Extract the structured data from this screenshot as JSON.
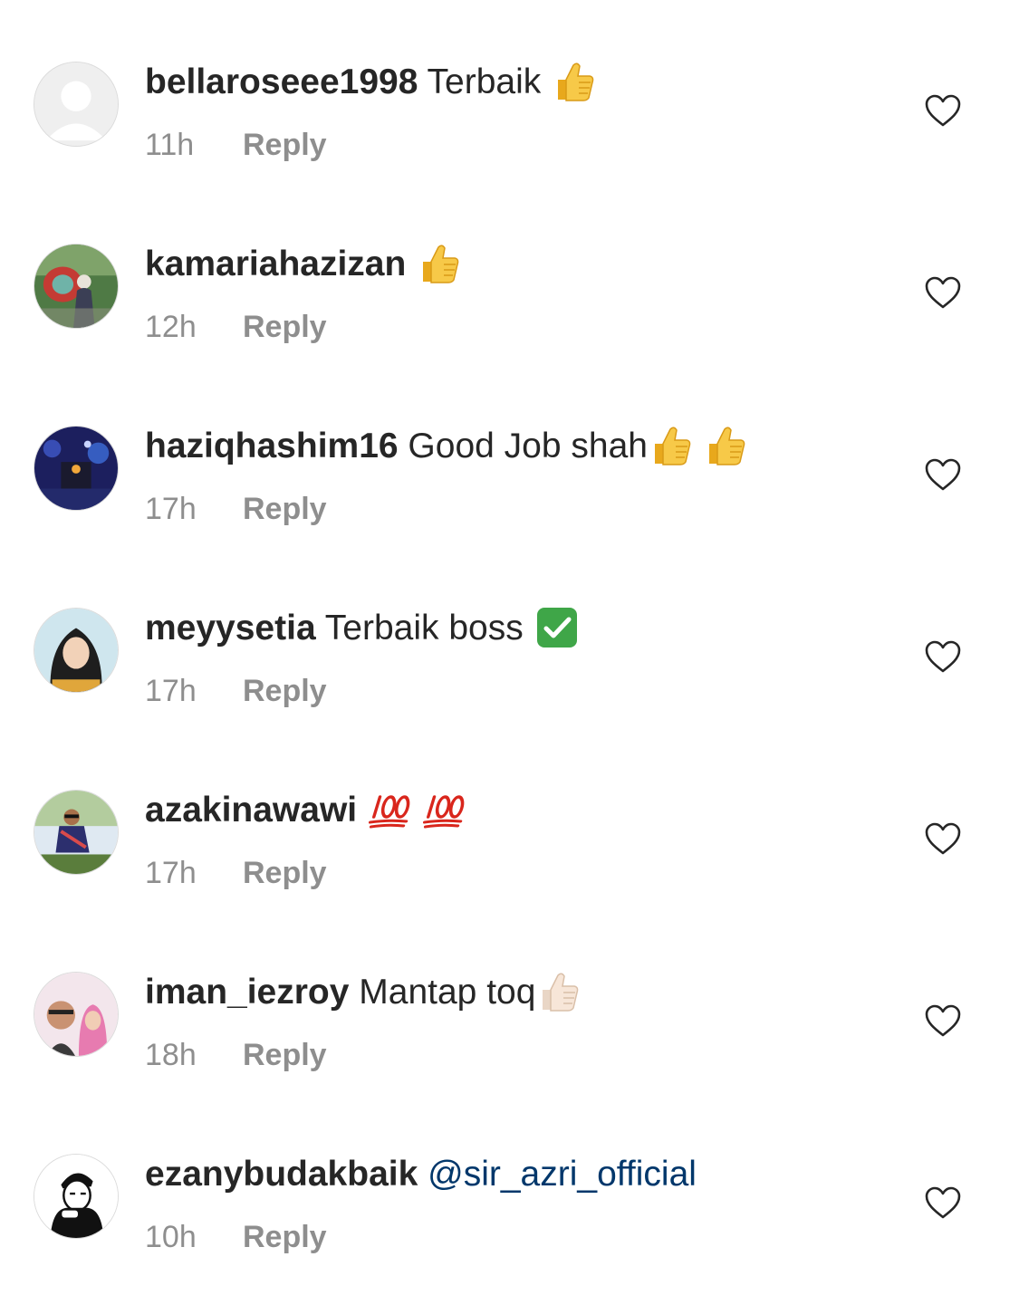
{
  "comments": [
    {
      "username": "bellaroseee1998",
      "text": " Terbaik ",
      "mention": "",
      "emojis": [
        "thumbs-up"
      ],
      "time": "11h",
      "reply_label": "Reply",
      "avatar": "default-avatar"
    },
    {
      "username": "kamariahazizan",
      "text": " ",
      "mention": "",
      "emojis": [
        "thumbs-up"
      ],
      "time": "12h",
      "reply_label": "Reply",
      "avatar": "photo-avatar"
    },
    {
      "username": "haziqhashim16",
      "text": " Good Job shah",
      "mention": "",
      "emojis": [
        "thumbs-up",
        "thumbs-up"
      ],
      "time": "17h",
      "reply_label": "Reply",
      "avatar": "photo-avatar"
    },
    {
      "username": "meyysetia",
      "text": " Terbaik boss ",
      "mention": "",
      "emojis": [
        "check-mark"
      ],
      "time": "17h",
      "reply_label": "Reply",
      "avatar": "photo-avatar"
    },
    {
      "username": "azakinawawi",
      "text": " ",
      "mention": "",
      "emojis": [
        "hundred-points",
        "hundred-points"
      ],
      "time": "17h",
      "reply_label": "Reply",
      "avatar": "photo-avatar"
    },
    {
      "username": "iman_iezroy",
      "text": " Mantap toq",
      "mention": "",
      "emojis": [
        "thumbs-up-light"
      ],
      "time": "18h",
      "reply_label": "Reply",
      "avatar": "photo-avatar"
    },
    {
      "username": "ezanybudakbaik",
      "text": " ",
      "mention": "@sir_azri_official",
      "emojis": [],
      "time": "10h",
      "reply_label": "Reply",
      "avatar": "illustration-avatar"
    }
  ],
  "colors": {
    "text": "#262626",
    "secondary": "#8e8e8e",
    "mention": "#00376b",
    "heart_outline": "#262626"
  },
  "icons": {
    "like": "heart-outline-icon",
    "thumbs-up": "thumbs-up-emoji-icon",
    "check-mark": "check-mark-button-emoji-icon",
    "hundred-points": "hundred-points-emoji-icon"
  }
}
